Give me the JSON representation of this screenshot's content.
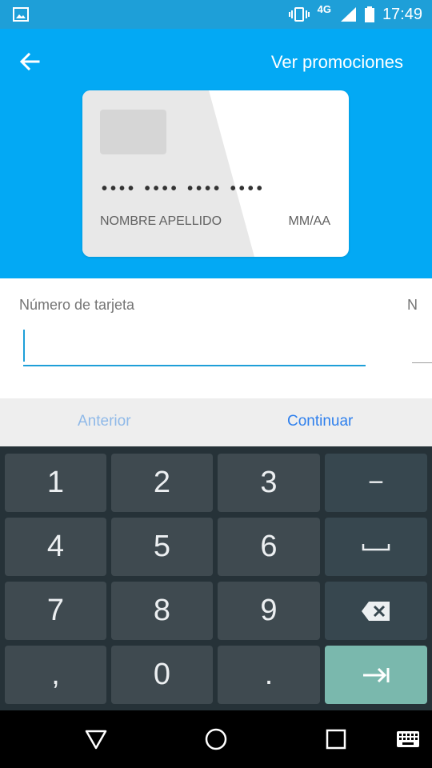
{
  "status_bar": {
    "time": "17:49",
    "network": "4G",
    "icons": [
      "image-icon",
      "vibrate-icon",
      "signal-icon",
      "battery-icon"
    ]
  },
  "header": {
    "promo_label": "Ver promociones",
    "back_icon": "arrow-left-icon"
  },
  "card": {
    "number_mask": "•••• •••• •••• ••••",
    "name_placeholder": "NOMBRE APELLIDO",
    "expiry_placeholder": "MM/AA"
  },
  "form": {
    "number_label": "Número de tarjeta",
    "number_value": "",
    "next_label_partial": "N"
  },
  "navigation": {
    "previous_label": "Anterior",
    "continue_label": "Continuar"
  },
  "keyboard": {
    "keys": [
      "1",
      "2",
      "3",
      "−",
      "4",
      "5",
      "6",
      "space",
      "7",
      "8",
      "9",
      "backspace",
      ",",
      "0",
      ".",
      "tab"
    ]
  },
  "colors": {
    "header_bg": "#03a9f4",
    "status_bg": "#1e9fd8",
    "accent": "#2f80ed",
    "keyboard_bg": "#263238",
    "key_bg": "#3f4a50",
    "go_key_bg": "#7ab8ad"
  }
}
